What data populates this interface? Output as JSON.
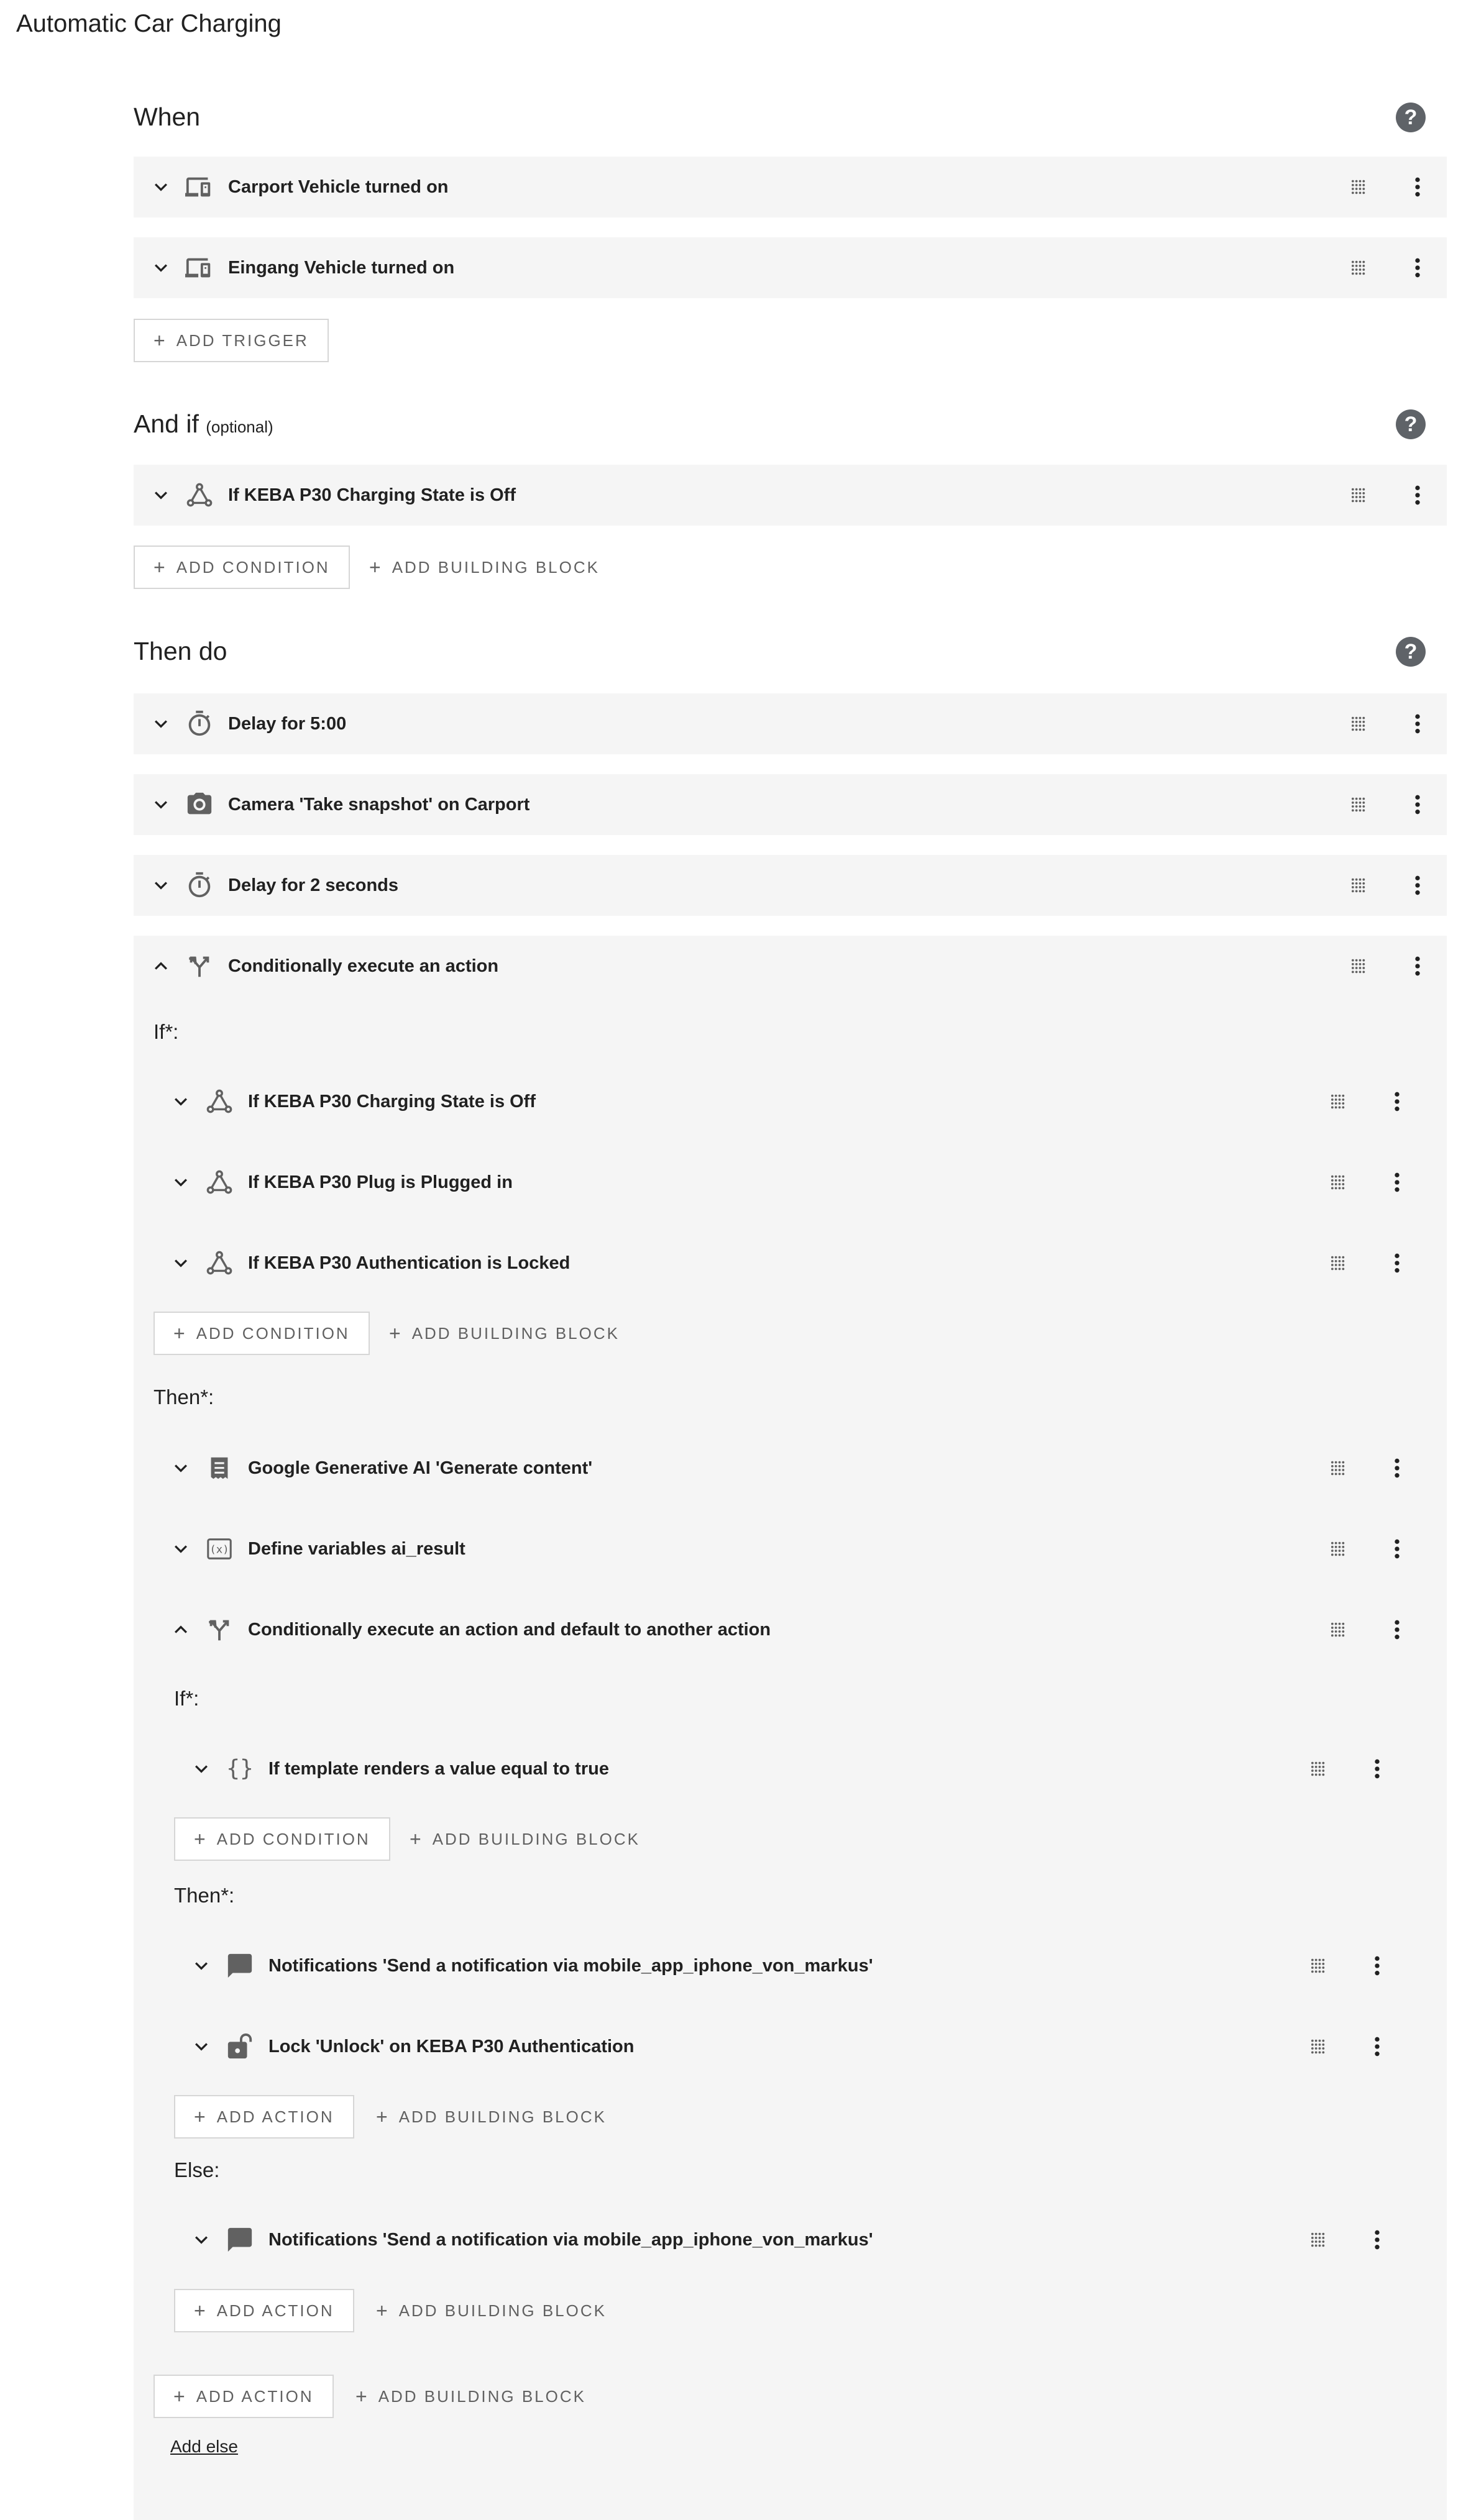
{
  "page": {
    "title": "Automatic Car Charging"
  },
  "when": {
    "title": "When",
    "triggers": [
      {
        "label": "Carport Vehicle turned on",
        "icon": "devices-icon"
      },
      {
        "label": "Eingang Vehicle turned on",
        "icon": "devices-icon"
      }
    ],
    "add_trigger": "ADD TRIGGER"
  },
  "and_if": {
    "title": "And if",
    "optional": "(optional)",
    "conditions": [
      {
        "label": "If KEBA P30 Charging State is Off",
        "icon": "state-graph-icon"
      }
    ],
    "add_condition": "ADD CONDITION",
    "add_building_block": "ADD BUILDING BLOCK"
  },
  "then_do": {
    "title": "Then do",
    "actions": [
      {
        "label": "Delay for 5:00",
        "icon": "timer-icon"
      },
      {
        "label": "Camera 'Take snapshot' on Carport",
        "icon": "camera-icon"
      },
      {
        "label": "Delay for 2 seconds",
        "icon": "timer-icon"
      },
      {
        "label": "Conditionally execute an action",
        "icon": "branch-icon"
      }
    ],
    "cond": {
      "if_label": "If*:",
      "conditions": [
        {
          "label": "If KEBA P30 Charging State is Off"
        },
        {
          "label": "If KEBA P30 Plug is Plugged in"
        },
        {
          "label": "If KEBA P30 Authentication is Locked"
        }
      ],
      "add_condition": "ADD CONDITION",
      "add_building_block": "ADD BUILDING BLOCK",
      "then_label": "Then*:",
      "then_actions": [
        {
          "label": "Google Generative AI 'Generate content'"
        },
        {
          "label": "Define variables ai_result"
        },
        {
          "label": "Conditionally execute an action and default to another action"
        }
      ],
      "inner": {
        "if_label": "If*:",
        "conditions": [
          {
            "label": "If template renders a value equal to true"
          }
        ],
        "add_condition": "ADD CONDITION",
        "add_building_block": "ADD BUILDING BLOCK",
        "then_label": "Then*:",
        "then_actions": [
          {
            "label": "Notifications 'Send a notification via mobile_app_iphone_von_markus'"
          },
          {
            "label": "Lock 'Unlock' on KEBA P30 Authentication"
          }
        ],
        "add_action": "ADD ACTION",
        "else_label": "Else:",
        "else_actions": [
          {
            "label": "Notifications 'Send a notification via mobile_app_iphone_von_markus'"
          }
        ]
      },
      "add_action": "ADD ACTION",
      "add_else": "Add else"
    }
  }
}
